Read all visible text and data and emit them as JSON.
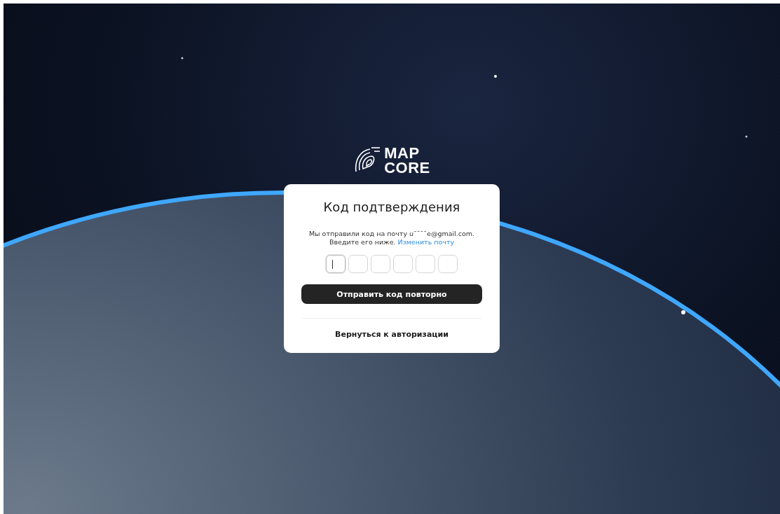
{
  "logo": {
    "lines": [
      "MAP",
      "CORE"
    ]
  },
  "card": {
    "title": "Код подтверждения",
    "message": "Мы отправили код на почту u¯¯¯¯e@gmail.com.",
    "message_line_2": "Введите его ниже.",
    "change_email_link": "Изменить почту",
    "code_boxes": [
      {
        "focused": true
      },
      {
        "focused": false
      },
      {
        "focused": false
      },
      {
        "focused": false
      },
      {
        "focused": false
      },
      {
        "focused": false
      }
    ],
    "resend_button": "Отправить код повторно",
    "back_link": "Вернуться к авторизации"
  }
}
